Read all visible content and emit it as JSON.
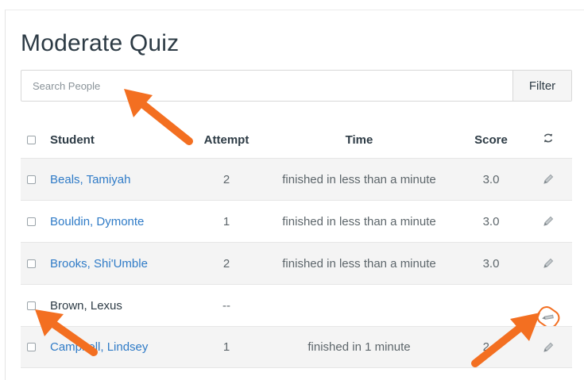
{
  "page": {
    "title": "Moderate Quiz"
  },
  "search": {
    "placeholder": "Search People",
    "filter_label": "Filter"
  },
  "table": {
    "headers": {
      "student": "Student",
      "attempt": "Attempt",
      "time": "Time",
      "score": "Score",
      "action_icon": "refresh-icon"
    },
    "rows": [
      {
        "student": "Beals, Tamiyah",
        "attempt": "2",
        "time": "finished in less than a minute",
        "score": "3.0",
        "link": true
      },
      {
        "student": "Bouldin, Dymonte",
        "attempt": "1",
        "time": "finished in less than a minute",
        "score": "3.0",
        "link": true
      },
      {
        "student": "Brooks, Shi'Umble",
        "attempt": "2",
        "time": "finished in less than a minute",
        "score": "3.0",
        "link": true
      },
      {
        "student": "Brown, Lexus",
        "attempt": "--",
        "time": "",
        "score": "",
        "link": false
      },
      {
        "student": "Campbell, Lindsey",
        "attempt": "1",
        "time": "finished in 1 minute",
        "score": "2.0",
        "link": true
      }
    ]
  },
  "colors": {
    "link": "#2f7bc7",
    "text": "#2d3b45",
    "annotation_arrow": "#f36f21"
  },
  "icons": {
    "row_action": "pencil-icon",
    "annotation": "arrow-icon"
  }
}
